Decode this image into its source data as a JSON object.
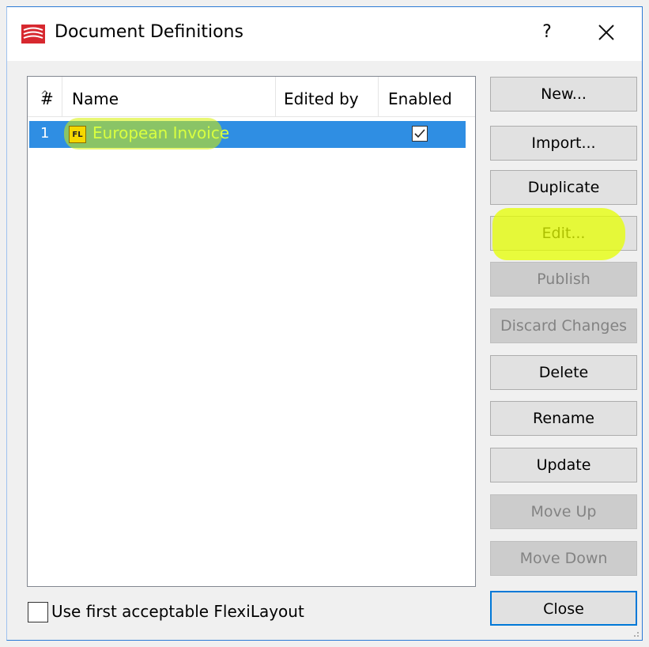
{
  "window": {
    "title": "Document Definitions",
    "help_label": "?"
  },
  "list": {
    "columns": [
      "#",
      "Name",
      "Edited by",
      "Enabled"
    ],
    "rows": [
      {
        "num": "1",
        "badge": "FL",
        "name": "European Invoice",
        "edited_by": "",
        "enabled": true,
        "selected": true
      }
    ]
  },
  "buttons": {
    "new": "New...",
    "import": "Import...",
    "duplicate": "Duplicate",
    "edit": "Edit...",
    "publish": "Publish",
    "discard": "Discard Changes",
    "delete": "Delete",
    "rename": "Rename",
    "update": "Update",
    "move_up": "Move Up",
    "move_down": "Move Down",
    "close": "Close"
  },
  "options": {
    "use_first_flexilayout": "Use first acceptable FlexiLayout",
    "use_first_flexilayout_checked": false
  },
  "colors": {
    "selection": "#2f8ee3",
    "highlight": "#e6ff00",
    "accent": "#0078d7"
  }
}
